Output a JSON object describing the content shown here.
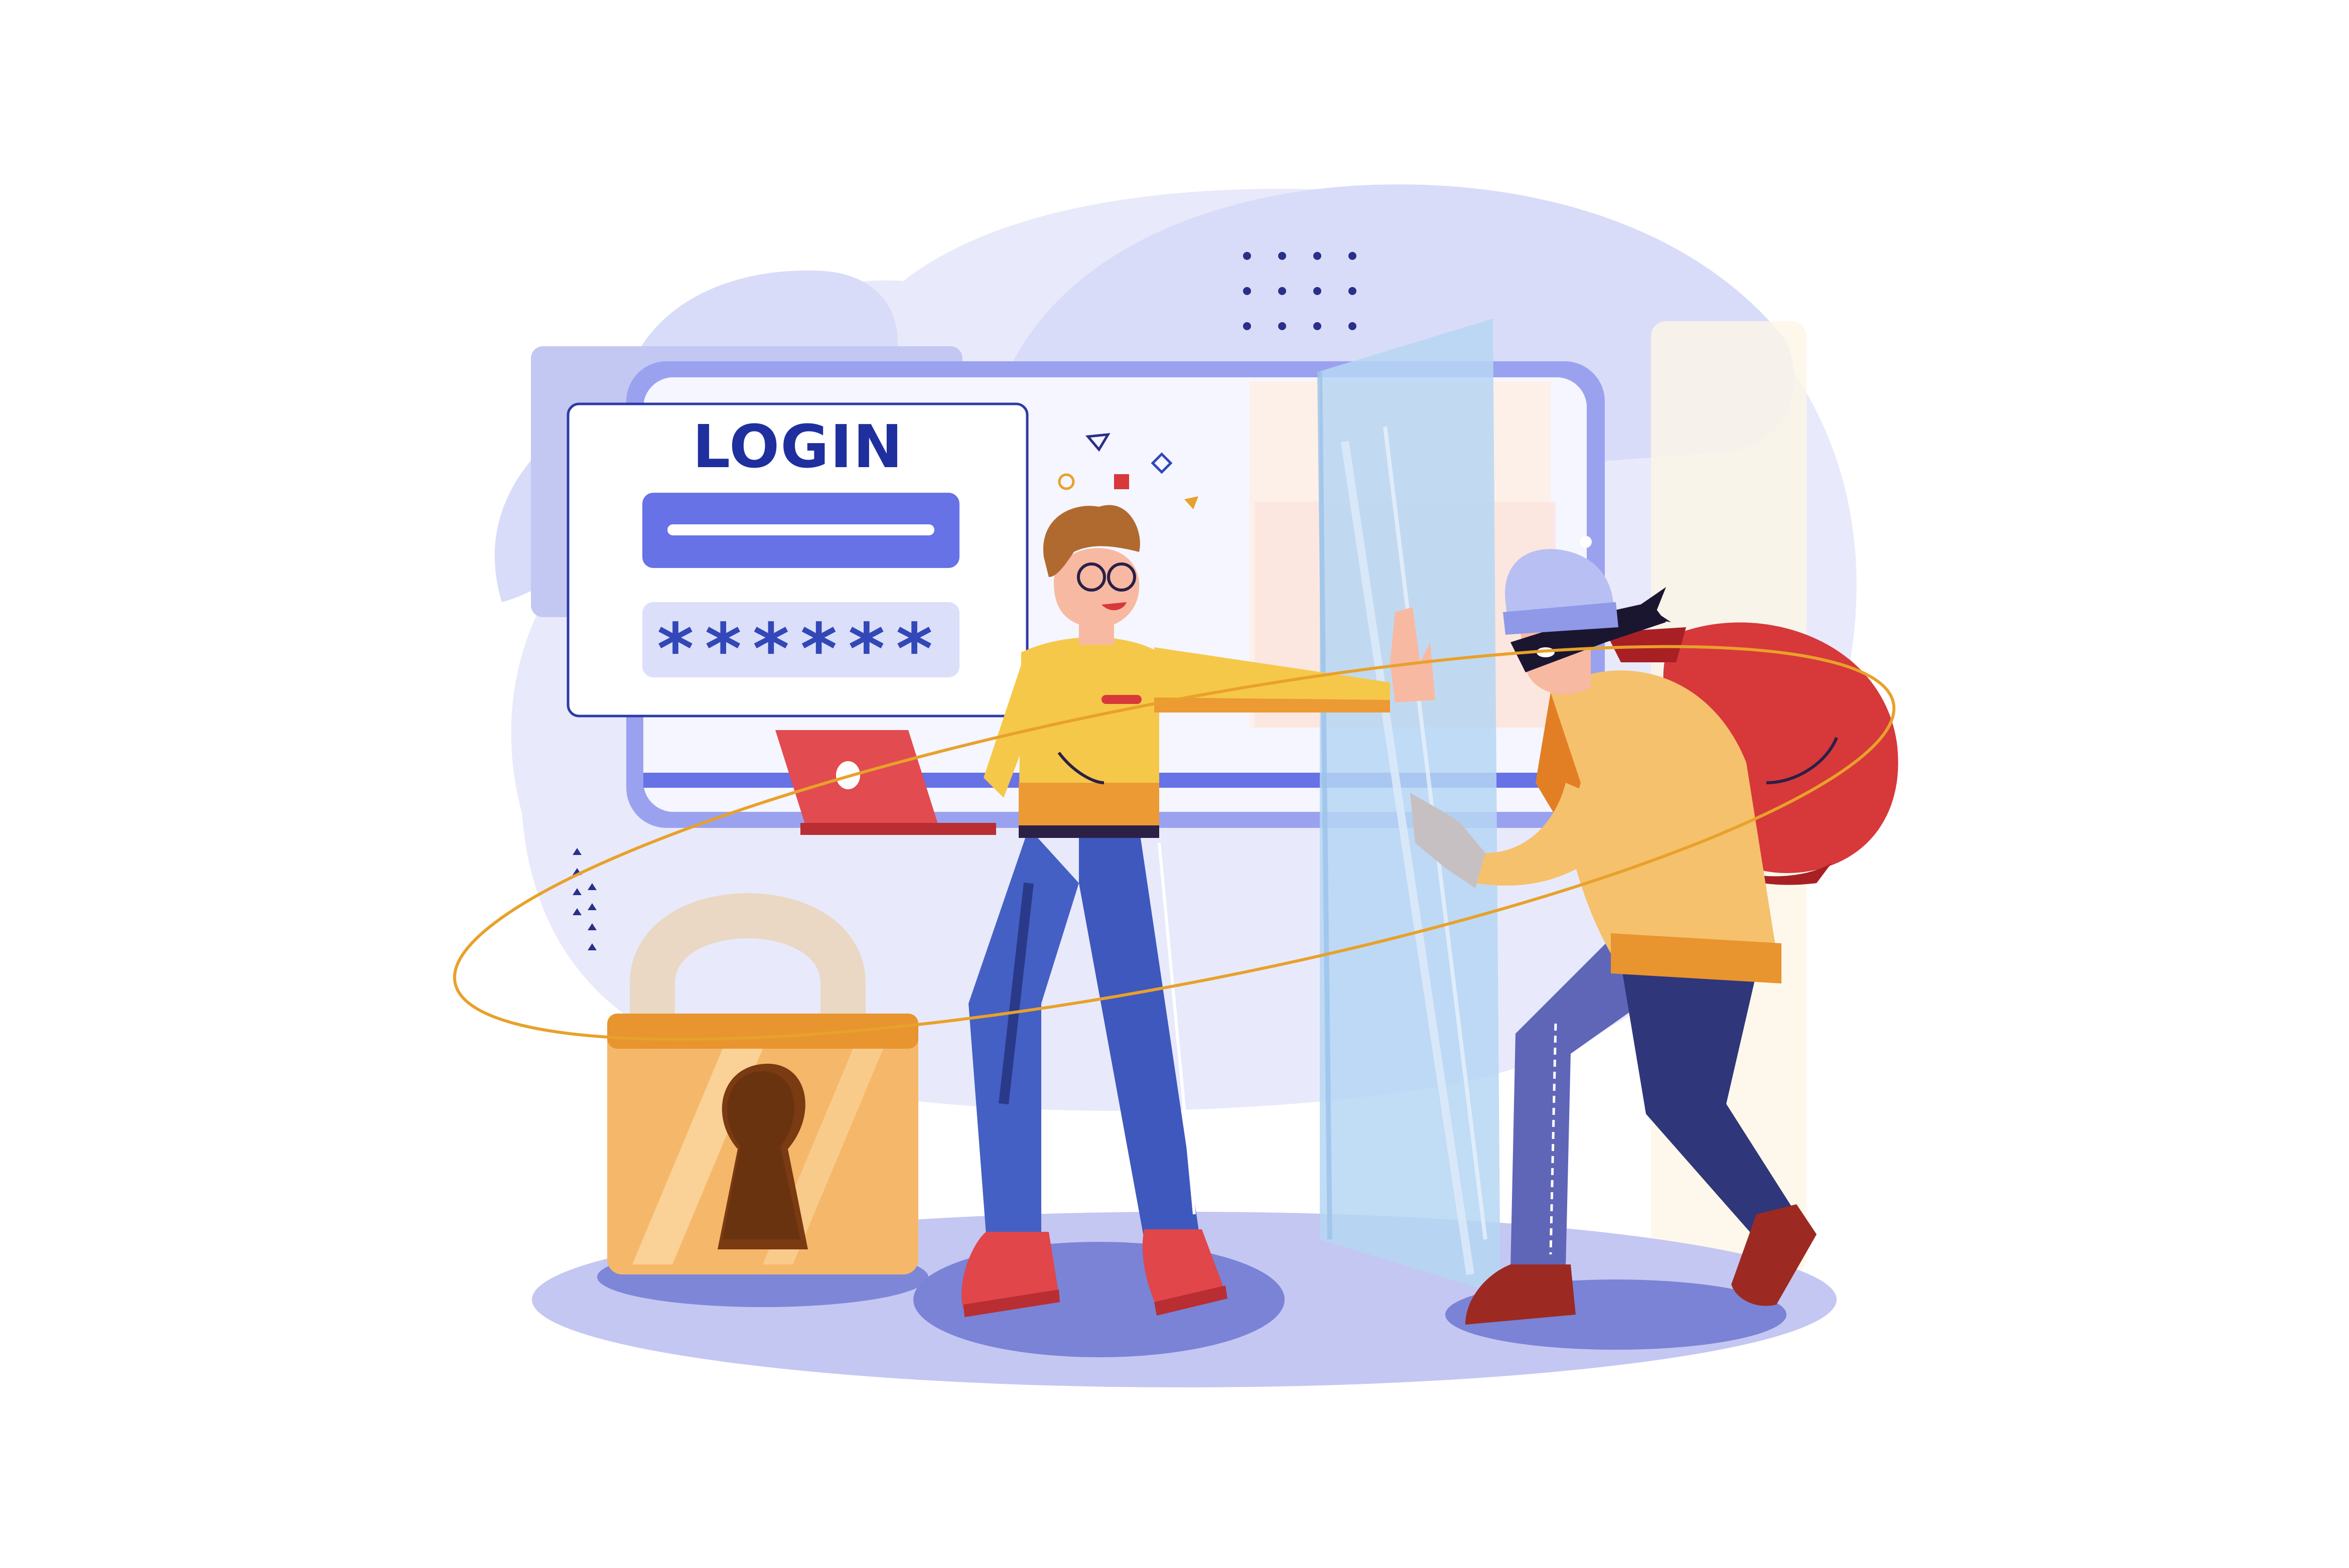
{
  "login_form": {
    "title": "LOGIN",
    "username_field_value": "",
    "password_mask": "******"
  },
  "icons": [
    "padlock-icon",
    "laptop-icon",
    "loot-bag-icon",
    "glass-shield-icon",
    "decorative-dots-icon",
    "confetti-icon"
  ],
  "colors": {
    "accent_blue": "#6672e6",
    "title_blue": "#1f2f9e",
    "lock_orange": "#f5b86a",
    "bag_red": "#d7383a",
    "backdrop_lavender": "#dcdffa",
    "orbit_line": "#e8a12a"
  }
}
